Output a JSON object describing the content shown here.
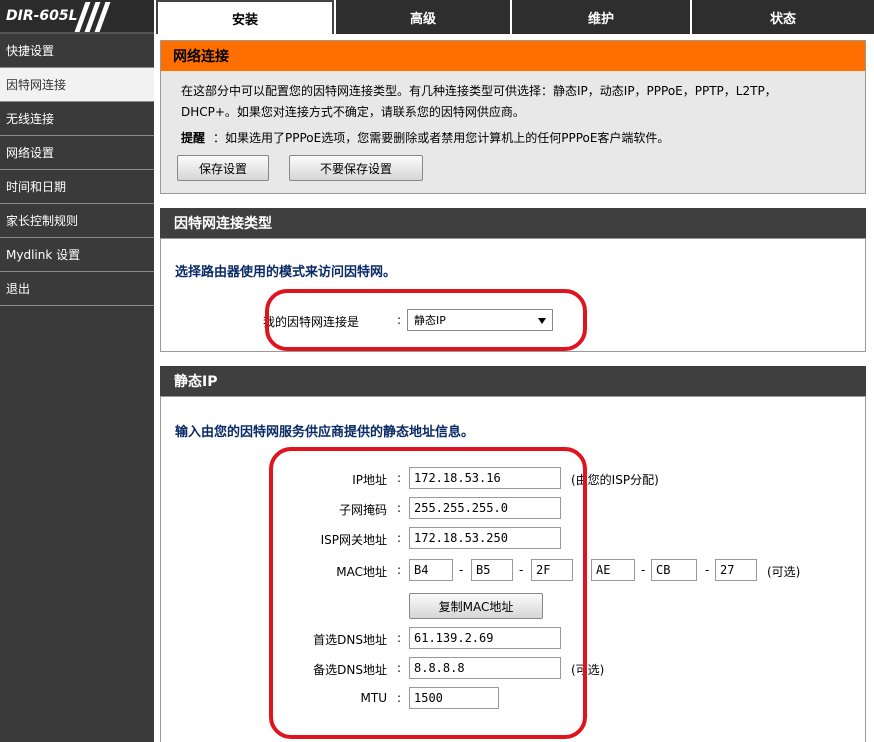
{
  "brand": {
    "model": "DIR-605L"
  },
  "tabs": [
    {
      "label": "安装",
      "active": true
    },
    {
      "label": "高级",
      "active": false
    },
    {
      "label": "维护",
      "active": false
    },
    {
      "label": "状态",
      "active": false
    }
  ],
  "sidebar": {
    "items": [
      {
        "label": "快捷设置"
      },
      {
        "label": "因特网连接",
        "active": true
      },
      {
        "label": "无线连接"
      },
      {
        "label": "网络设置"
      },
      {
        "label": "时间和日期"
      },
      {
        "label": "家长控制规则"
      },
      {
        "label": "Mydlink 设置"
      },
      {
        "label": "退出"
      }
    ]
  },
  "network": {
    "title": "网络连接",
    "intro": "在这部分中可以配置您的因特网连接类型。有几种连接类型可供选择：静态IP，动态IP，PPPoE，PPTP，L2TP，DHCP+。如果您对连接方式不确定，请联系您的因特网供应商。",
    "warning_label": "提醒",
    "warning_text": "：如果选用了PPPoE选项，您需要删除或者禁用您计算机上的任何PPPoE客户端软件。",
    "save_label": "保存设置",
    "dont_save_label": "不要保存设置"
  },
  "conn_type": {
    "header": "因特网连接类型",
    "instruction": "选择路由器使用的模式来访问因特网。",
    "label": "我的因特网连接是",
    "value": "静态IP"
  },
  "static_ip": {
    "header": "静态IP",
    "instruction": "输入由您的因特网服务供应商提供的静态地址信息。",
    "ip_label": "IP地址",
    "ip_value": "172.18.53.16",
    "ip_note": "(由您的ISP分配)",
    "mask_label": "子网掩码",
    "mask_value": "255.255.255.0",
    "gateway_label": "ISP网关地址",
    "gateway_value": "172.18.53.250",
    "mac_label": "MAC地址",
    "mac": [
      "B4",
      "B5",
      "2F",
      "AE",
      "CB",
      "27"
    ],
    "mac_note": "(可选)",
    "clone_label": "复制MAC地址",
    "dns1_label": "首选DNS地址",
    "dns1_value": "61.139.2.69",
    "dns2_label": "备选DNS地址",
    "dns2_value": "8.8.8.8",
    "dns2_note": "(可选)",
    "mtu_label": "MTU",
    "mtu_value": "1500",
    "colon": ":",
    "dash": "-"
  },
  "colors": {
    "accent": "#ff6f00",
    "highlight": "#e0141e",
    "title_blue": "#0a2a66",
    "dark": "#3a3a3a"
  }
}
